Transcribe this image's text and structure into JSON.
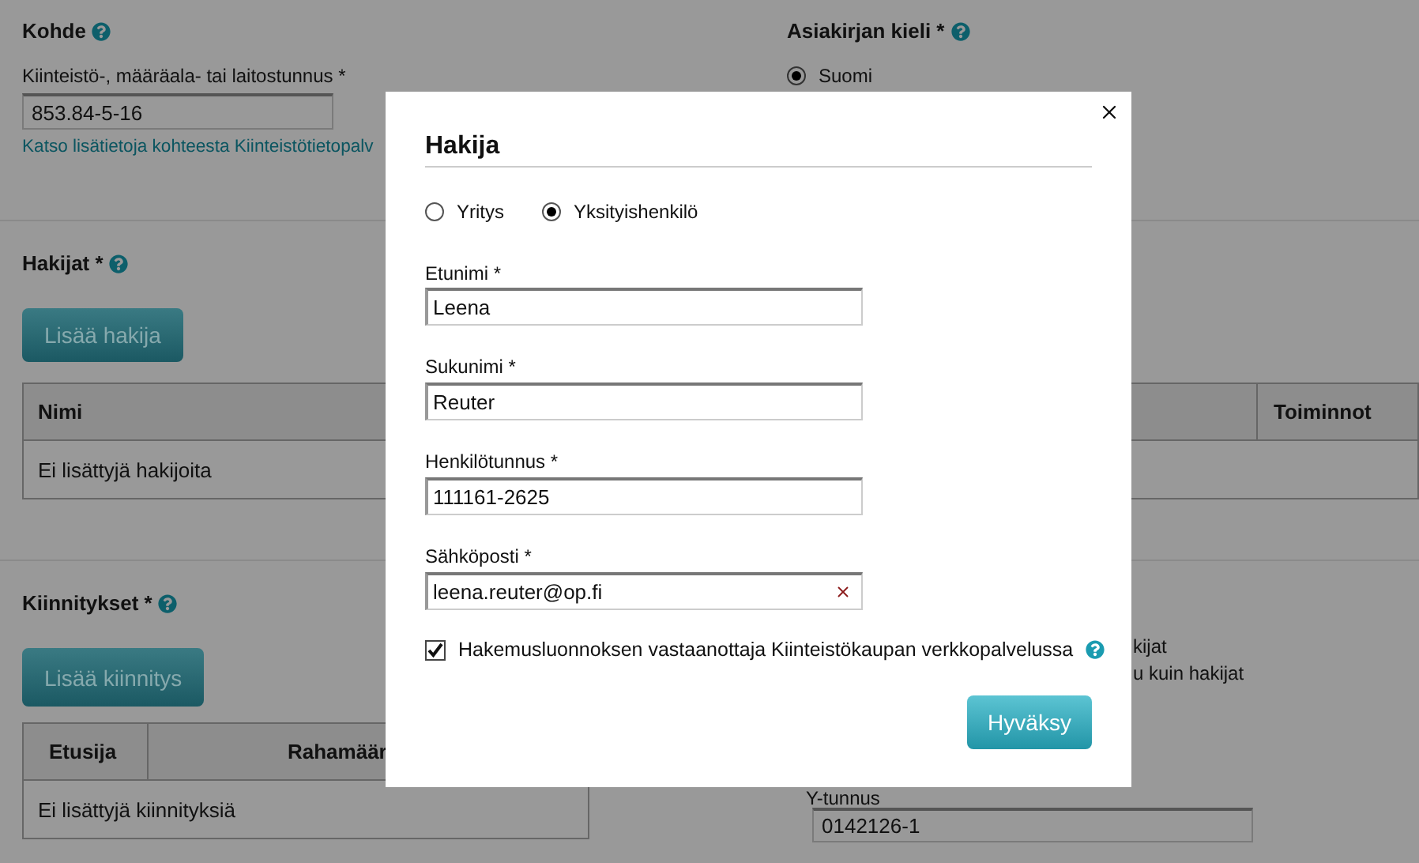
{
  "page": {
    "target": {
      "title": "Kohde",
      "field_label": "Kiinteistö-, määräala- tai laitostunnus *",
      "field_value": "853.84-5-16",
      "link": "Katso lisätietoja kohteesta Kiinteistötietopalv"
    },
    "document_language": {
      "title": "Asiakirjan kieli *",
      "options": [
        {
          "label": "Suomi",
          "selected": true
        }
      ]
    },
    "applicants": {
      "title": "Hakijat *",
      "button": "Lisää hakija",
      "columns": [
        "Nimi",
        "Toiminnot"
      ],
      "empty_text": "Ei lisättyjä hakijoita"
    },
    "mortgages": {
      "title": "Kiinnitykset *",
      "button": "Lisää kiinnitys",
      "columns": [
        "Etusija",
        "Rahamäär"
      ],
      "empty_text": "Ei lisättyjä kiinnityksiä"
    },
    "right_fragments": [
      "kijat",
      "u kuin hakijat"
    ],
    "business_id": {
      "label": "Y-tunnus",
      "value": "0142126-1"
    }
  },
  "dialog": {
    "title": "Hakija",
    "type_options": [
      {
        "label": "Yritys",
        "selected": false
      },
      {
        "label": "Yksityishenkilö",
        "selected": true
      }
    ],
    "fields": [
      {
        "label": "Etunimi *",
        "value": "Leena",
        "clearable": false
      },
      {
        "label": "Sukunimi *",
        "value": "Reuter",
        "clearable": false
      },
      {
        "label": "Henkilötunnus *",
        "value": "111161-2625",
        "clearable": false
      },
      {
        "label": "Sähköposti *",
        "value": "leena.reuter@op.fi",
        "clearable": true
      }
    ],
    "recipient": {
      "label": "Hakemusluonnoksen vastaanottaja Kiinteistökaupan verkkopalvelussa",
      "checked": true
    },
    "accept_button": "Hyväksy"
  }
}
